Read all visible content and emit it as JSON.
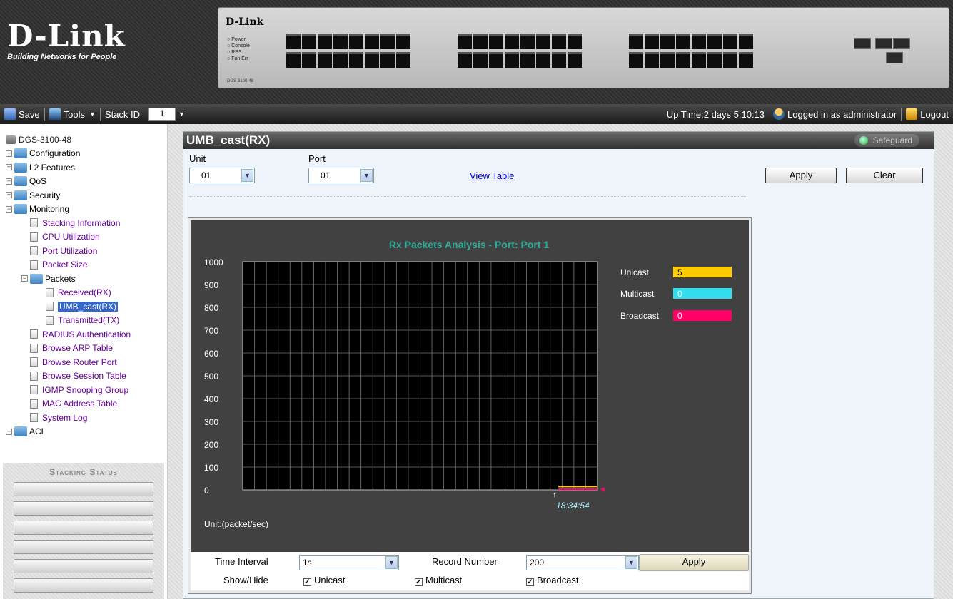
{
  "banner": {
    "logo": "D-Link",
    "tagline": "Building Networks for People",
    "device_brand": "D-Link",
    "device_leds": [
      "Power",
      "Console",
      "RPS",
      "Fan Err"
    ],
    "device_model": "DGS-3100-48"
  },
  "toolbar": {
    "save": "Save",
    "tools": "Tools",
    "stack_id_label": "Stack ID",
    "stack_id_value": "1",
    "uptime": "Up Time:2 days 5:10:13",
    "logged_in": "Logged in as administrator",
    "logout": "Logout"
  },
  "tree": {
    "root": "DGS-3100-48",
    "items": [
      {
        "label": "Configuration"
      },
      {
        "label": "L2 Features"
      },
      {
        "label": "QoS"
      },
      {
        "label": "Security"
      },
      {
        "label": "Monitoring"
      },
      {
        "label": "Stacking Information"
      },
      {
        "label": "CPU Utilization"
      },
      {
        "label": "Port Utilization"
      },
      {
        "label": "Packet Size"
      },
      {
        "label": "Packets"
      },
      {
        "label": "Received(RX)"
      },
      {
        "label": "UMB_cast(RX)"
      },
      {
        "label": "Transmitted(TX)"
      },
      {
        "label": "RADIUS Authentication"
      },
      {
        "label": "Browse ARP Table"
      },
      {
        "label": "Browse Router Port"
      },
      {
        "label": "Browse Session Table"
      },
      {
        "label": "IGMP Snooping Group"
      },
      {
        "label": "MAC Address Table"
      },
      {
        "label": "System Log"
      },
      {
        "label": "ACL"
      }
    ],
    "stacking_title": "Stacking Status"
  },
  "panel": {
    "title": "UMB_cast(RX)",
    "safeguard": "Safeguard",
    "unit_label": "Unit",
    "unit_value": "01",
    "port_label": "Port",
    "port_value": "01",
    "view_table": "View Table",
    "apply": "Apply",
    "clear": "Clear"
  },
  "chart_data": {
    "type": "line",
    "title": "Rx Packets Analysis - Port: Port 1",
    "ylabel": "Unit:(packet/sec)",
    "ylim": [
      0,
      1000
    ],
    "yticks": [
      1000,
      900,
      800,
      700,
      600,
      500,
      400,
      300,
      200,
      100,
      0
    ],
    "x": [
      "18:34:54"
    ],
    "series": [
      {
        "name": "Unicast",
        "values": [
          5
        ],
        "color": "#ffcc00"
      },
      {
        "name": "Multicast",
        "values": [
          0
        ],
        "color": "#33ddee"
      },
      {
        "name": "Broadcast",
        "values": [
          0
        ],
        "color": "#ff0066"
      }
    ],
    "grid": true
  },
  "controls": {
    "time_interval_label": "Time Interval",
    "time_interval_value": "1s",
    "record_number_label": "Record Number",
    "record_number_value": "200",
    "apply": "Apply",
    "showhide_label": "Show/Hide",
    "unicast": "Unicast",
    "multicast": "Multicast",
    "broadcast": "Broadcast"
  },
  "colors": {
    "chart_bg": "#414141",
    "plot_bg": "#000000",
    "title": "#33aa99",
    "link": "#0000cc",
    "tree_link": "#660099",
    "selected": "#3366cc"
  }
}
